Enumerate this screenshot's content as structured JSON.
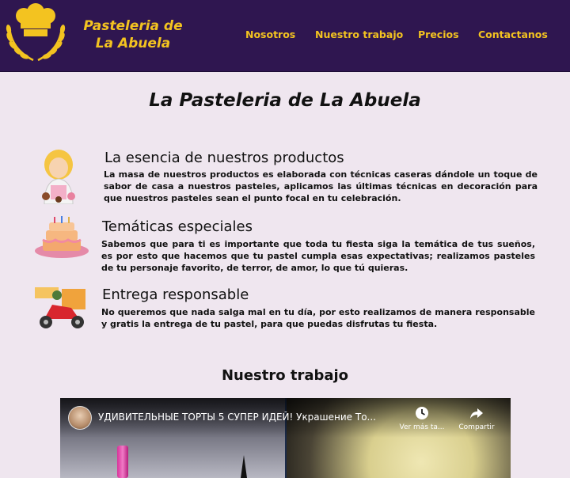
{
  "brand": {
    "line1": "Pasteleria de",
    "line2": "La Abuela"
  },
  "nav": [
    "Nosotros",
    "Nuestro trabajo",
    "Precios",
    "Contactanos"
  ],
  "page_title": "La Pasteleria de La Abuela",
  "features": [
    {
      "icon": "grandma-baker-icon",
      "title": "La esencia de nuestros productos",
      "text": "La masa de nuestros productos es elaborada con técnicas caseras dándole un toque de sabor de casa a nuestros pasteles, aplicamos las últimas técnicas en decoración para que nuestros pasteles sean el punto focal en tu celebración."
    },
    {
      "icon": "birthday-cake-icon",
      "title": "Temáticas especiales",
      "text": "Sabemos que para ti es importante que toda tu fiesta siga la temática de tus sueños, es por esto que hacemos que tu pastel cumpla esas expectativas; realizamos pasteles de tu personaje favorito, de terror, de amor, lo que tú quieras."
    },
    {
      "icon": "delivery-scooter-icon",
      "title": "Entrega responsable",
      "text": "No queremos que nada salga mal en tu día, por esto realizamos de manera responsable y gratis la entrega de tu pastel, para que puedas disfrutas tu fiesta."
    }
  ],
  "section_title": "Nuestro trabajo",
  "video": {
    "title": "УДИВИТЕЛЬНЫЕ ТОРТЫ 5 СУПЕР ИДЕЙ! Украшение То...",
    "watch_later": "Ver más ta...",
    "share": "Compartir"
  },
  "colors": {
    "header_bg": "#2f1650",
    "accent": "#f3c320",
    "page_bg": "#efe6ef"
  }
}
